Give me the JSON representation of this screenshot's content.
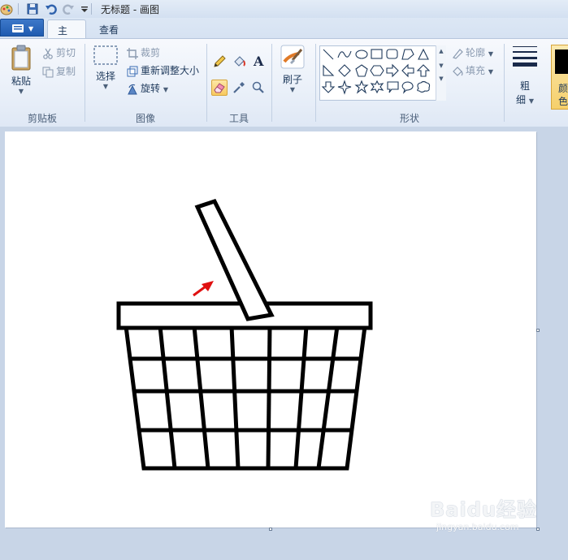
{
  "window": {
    "title": "无标题 - 画图"
  },
  "tabs": {
    "home": "主页",
    "view": "查看"
  },
  "clipboard": {
    "paste": "粘贴",
    "cut": "剪切",
    "copy": "复制",
    "group": "剪贴板"
  },
  "image": {
    "select": "选择",
    "crop": "裁剪",
    "resize": "重新调整大小",
    "rotate": "旋转",
    "group": "图像"
  },
  "tools": {
    "group": "工具",
    "text_glyph": "A"
  },
  "brushes": {
    "label": "刷子"
  },
  "shapes": {
    "outline": "轮廓",
    "fill": "填充",
    "group": "形状"
  },
  "size": {
    "label_line1": "粗",
    "label_line2": "细"
  },
  "colors": {
    "color1_line1": "颜",
    "color1_line2": "色",
    "accent": "#1f5bb0",
    "arrow_red": "#e01010"
  },
  "watermark": {
    "main": "Baidu经验",
    "sub": "jingyan.baidu.com"
  }
}
